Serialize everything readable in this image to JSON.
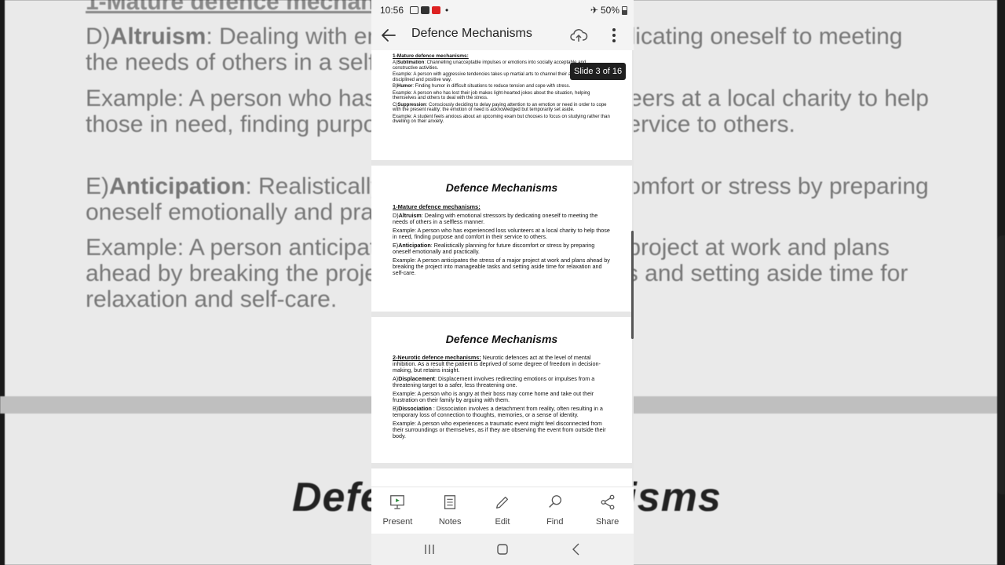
{
  "status_bar": {
    "time": "10:56",
    "battery": "50%"
  },
  "app_bar": {
    "title": "Defence Mechanisms"
  },
  "slide_indicator": "Slide 3 of 16",
  "slides": [
    {
      "heading": "1-Mature defence mechanisms:",
      "paragraphs": [
        {
          "prefix": "A)",
          "term": "Sublimation",
          "text": ": Channelling unacceptable impulses or emotions into socially acceptable and constructive activities."
        },
        {
          "prefix": "",
          "term": "",
          "text": "Example: A person with aggressive tendencies takes up martial arts to channel their aggression in a disciplined and positive way."
        },
        {
          "prefix": "B)",
          "term": "Humor",
          "text": ": Finding humor in difficult situations to reduce tension and cope with stress."
        },
        {
          "prefix": "",
          "term": "",
          "text": "Example: A person who has lost their job makes light-hearted jokes about the situation, helping themselves and others to deal with the stress."
        },
        {
          "prefix": "C)",
          "term": "Suppression",
          "text": ": Consciously deciding to delay paying attention to an emotion or need in order to cope with the present reality; the emotion or need is acknowledged but temporarily set aside."
        },
        {
          "prefix": "",
          "term": "",
          "text": "Example: A student feels anxious about an upcoming exam but chooses to focus on studying rather than dwelling on their anxiety."
        }
      ]
    },
    {
      "title": "Defence Mechanisms",
      "heading": "1-Mature defence mechanisms:",
      "paragraphs": [
        {
          "prefix": "D)",
          "term": "Altruism",
          "text": ": Dealing with emotional stressors by dedicating oneself to meeting the needs of others in a selfless manner."
        },
        {
          "prefix": "",
          "term": "",
          "text": "Example: A person who has experienced loss volunteers at a local charity to help those in need, finding purpose and comfort in their service to others."
        },
        {
          "prefix": "E)",
          "term": "Anticipation",
          "text": ": Realistically planning for future discomfort or stress by preparing oneself emotionally and practically."
        },
        {
          "prefix": "",
          "term": "",
          "text": "Example: A person anticipates the stress of a major project at work and plans ahead by breaking the project into manageable tasks and setting aside time for relaxation and self-care."
        }
      ]
    },
    {
      "title": "Defence Mechanisms",
      "heading": "2-Neurotic defence mechanisms:",
      "heading_text": " Neurotic defences act at the level of mental inhibition. As a result the patient is deprived of some degree of freedom in decision-making, but retains insight.",
      "paragraphs": [
        {
          "prefix": "A)",
          "term": "Displacement",
          "text": ": Displacement involves redirecting emotions or impulses from a threatening target to a safer, less threatening one."
        },
        {
          "prefix": "",
          "term": "",
          "text": "Example: A person who is angry at their boss may come home and take out their frustration on their family by arguing with them."
        },
        {
          "prefix": "B)",
          "term": "Dissociation",
          "text": " : Dissociation involves a detachment from reality, often resulting in a temporary loss of connection to thoughts, memories, or a sense of identity."
        },
        {
          "prefix": "",
          "term": "",
          "text": "Example: A person who experiences a traumatic event might feel disconnected from their surroundings or themselves, as if they are observing the event from outside their body."
        }
      ]
    }
  ],
  "background": {
    "heading": "1-Mature defence mechanisms:",
    "lines": [
      {
        "prefix": "D)",
        "term": "Altruism",
        "text": ": Dealing with emotional stressors by dedicating oneself to meeting the needs of others in a selfless manner."
      },
      {
        "prefix": "",
        "term": "",
        "text": "Example: A person who has experienced loss volunteers at a local charity to help those in need, finding purpose and comfort in their service to others."
      },
      {
        "prefix": "E)",
        "term": "Anticipation",
        "text": ": Realistically planning for future discomfort or stress by preparing oneself emotionally and practically."
      },
      {
        "prefix": "",
        "term": "",
        "text": "Example: A person anticipates the stress of a major project at work and plans ahead by breaking the project into manageable tasks and setting aside time for relaxation and self-care."
      }
    ],
    "title": "Defence Mechanisms"
  },
  "toolbar": [
    {
      "label": "Present",
      "icon": "present-icon"
    },
    {
      "label": "Notes",
      "icon": "notes-icon"
    },
    {
      "label": "Edit",
      "icon": "pencil-icon"
    },
    {
      "label": "Find",
      "icon": "search-icon"
    },
    {
      "label": "Share",
      "icon": "share-icon"
    }
  ]
}
